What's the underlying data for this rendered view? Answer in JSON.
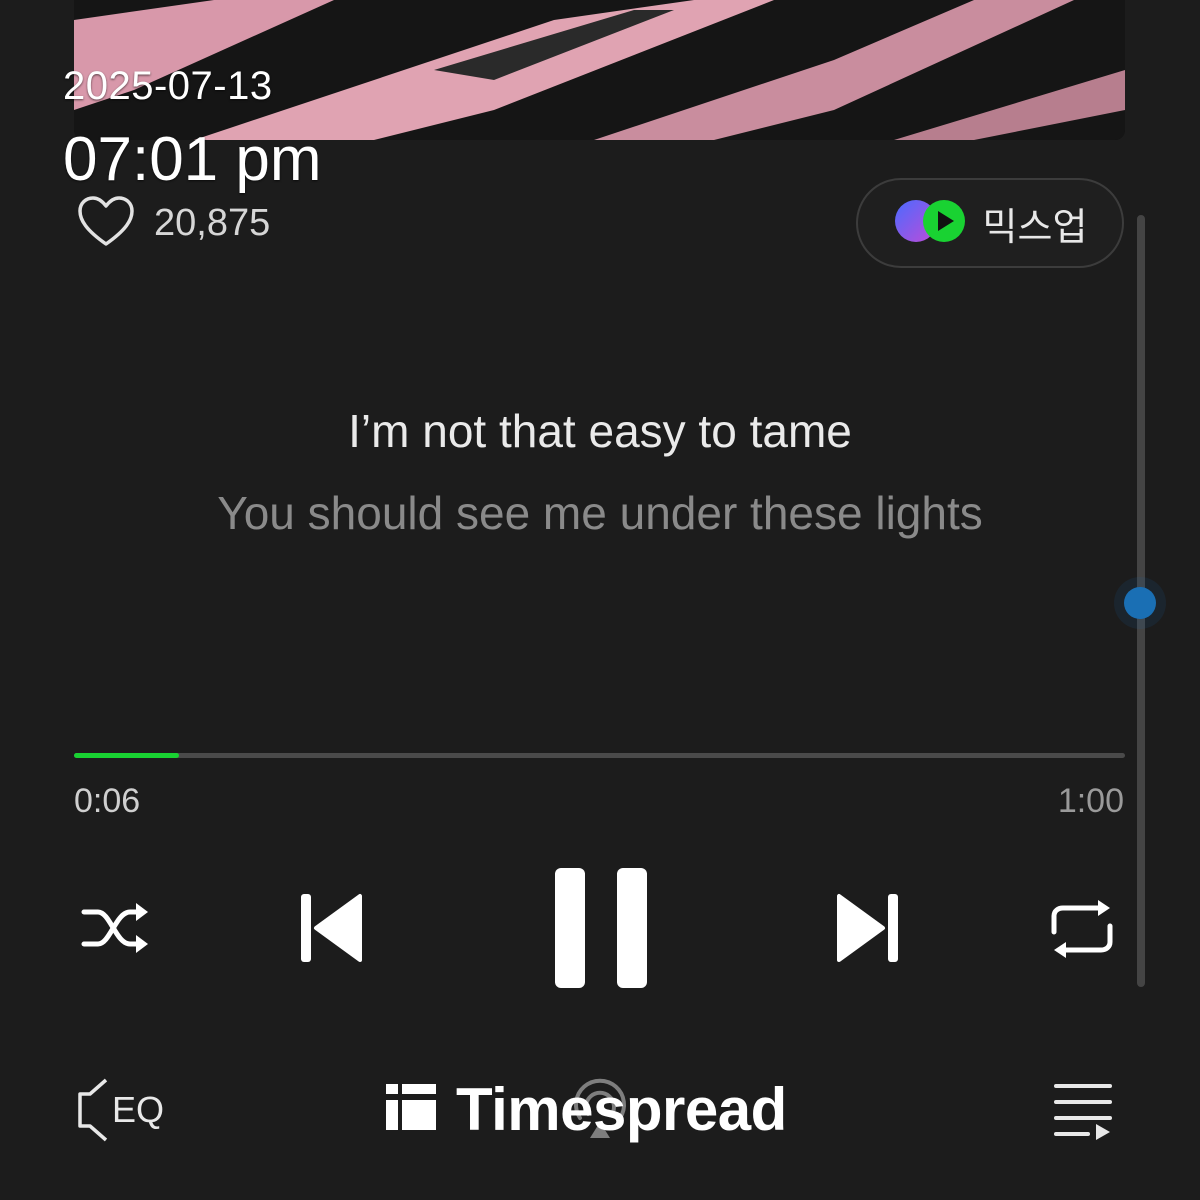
{
  "overlay": {
    "date": "2025-07-13",
    "time": "07:01 pm"
  },
  "like": {
    "count": "20,875",
    "icon": "heart-outline-icon"
  },
  "mixup": {
    "label": "믹스업",
    "icon": "mixup-icon",
    "colors": [
      "#7b5cff",
      "#19d232"
    ]
  },
  "lyrics": {
    "current": "I’m not that easy to tame",
    "next": "You should see me under these lights"
  },
  "playback": {
    "elapsed": "0:06",
    "total": "1:00",
    "progress": 0.1,
    "accent_color": "#19d232"
  },
  "controls": [
    "shuffle-icon",
    "previous-icon",
    "pause-icon",
    "next-icon",
    "repeat-icon"
  ],
  "bottom_bar": {
    "eq_label": "EQ",
    "icons": [
      "eq-icon",
      "cast-icon",
      "playlist-icon"
    ]
  },
  "watermark": {
    "brand": "Timespread"
  }
}
